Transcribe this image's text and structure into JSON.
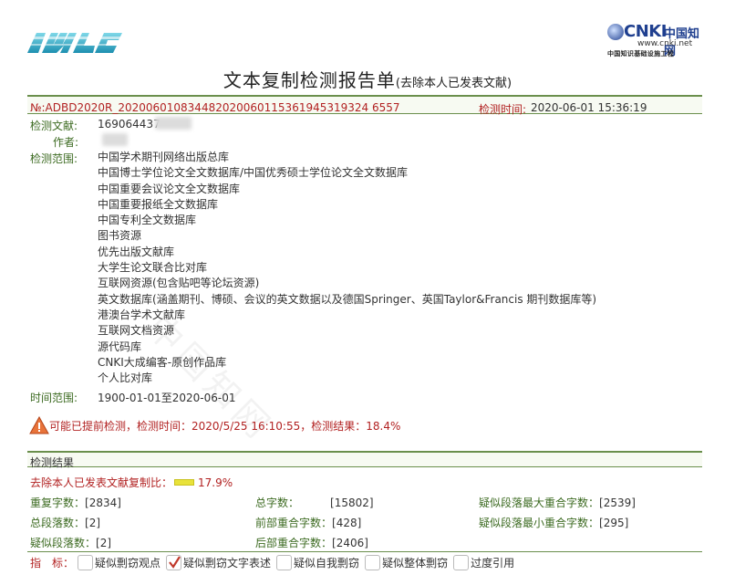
{
  "logos": {
    "cnki_brand": "CNKI",
    "cnki_chinese": "中国知网",
    "cnki_url": "www.cnki.net",
    "cnki_project": "中国知识基础设施工程"
  },
  "title": {
    "main": "文本复制检测报告单",
    "sub": "(去除本人已发表文献)"
  },
  "header": {
    "doc_no": "№:ADBD2020R_202006010834482020060115361945319324 6557",
    "detect_time_label": "检测时间:",
    "detect_time_value": "2020-06-01 15:36:19"
  },
  "info": {
    "doc_label": "检测文献:",
    "doc_value": "169064437",
    "author_label": "作者:",
    "scope_label": "检测范围:",
    "databases": [
      "中国学术期刊网络出版总库",
      "中国博士学位论文全文数据库/中国优秀硕士学位论文全文数据库",
      "中国重要会议论文全文数据库",
      "中国重要报纸全文数据库",
      "中国专利全文数据库",
      "图书资源",
      "优先出版文献库",
      "大学生论文联合比对库",
      "互联网资源(包含贴吧等论坛资源)",
      "英文数据库(涵盖期刊、博硕、会议的英文数据以及德国Springer、英国Taylor&Francis 期刊数据库等)",
      "港澳台学术文献库",
      "互联网文档资源",
      "源代码库",
      "CNKI大成编客-原创作品库",
      "个人比对库"
    ],
    "time_range_label": "时间范围:",
    "time_range_value": "1900-01-01至2020-06-01"
  },
  "watermark": "中国知网",
  "warning": {
    "text": "可能已提前检测，检测时间：2020/5/25 16:10:55，检测结果：18.4%"
  },
  "result": {
    "section_title": "检测结果",
    "ratio_label": "去除本人已发表文献复制比：",
    "ratio_value": "17.9%",
    "ratio_fraction": 0.179,
    "stats": [
      {
        "key": "重复字数：",
        "value": "[2834]"
      },
      {
        "key": "总字数：",
        "value": "[15802]"
      },
      {
        "key": "疑似段落最大重合字数：",
        "value": "[2539]"
      },
      {
        "key": "总段落数：",
        "value": "[2]"
      },
      {
        "key": "前部重合字数：",
        "value": "[428]"
      },
      {
        "key": "疑似段落最小重合字数：",
        "value": "[295]"
      },
      {
        "key": "疑似段落数：",
        "value": "[2]"
      },
      {
        "key": "后部重合字数：",
        "value": "[2406]"
      }
    ]
  },
  "indicators": {
    "label": "指　标：",
    "items": [
      {
        "label": "疑似剽窃观点",
        "checked": false
      },
      {
        "label": "疑似剽窃文字表述",
        "checked": true
      },
      {
        "label": "疑似自我剽窃",
        "checked": false
      },
      {
        "label": "疑似整体剽窃",
        "checked": false
      },
      {
        "label": "过度引用",
        "checked": false
      }
    ]
  },
  "colors": {
    "accent_green": "#3d6b22",
    "rule_green": "#6a8f4c",
    "alert_red": "#b22222",
    "ratio_yellow": "#e8e23a"
  }
}
